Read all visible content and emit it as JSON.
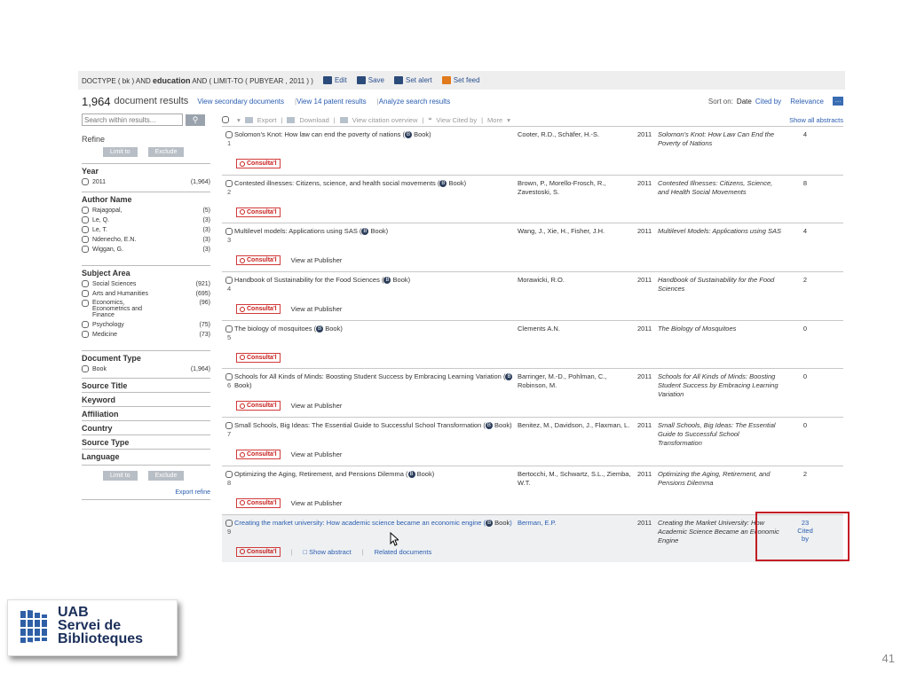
{
  "query": {
    "text_before": "DOCTYPE ( bk ) AND",
    "keyword": "education",
    "text_after": "AND ( LIMIT-TO ( PUBYEAR , 2011 ) )",
    "actions": [
      "Edit",
      "Save",
      "Set alert",
      "Set feed"
    ]
  },
  "results": {
    "count": "1,964",
    "label": "document results",
    "links": [
      "View secondary documents",
      "View 14 patent results",
      "Analyze search results"
    ],
    "sort_label": "Sort on:",
    "sort_options": [
      "Date",
      "Cited by",
      "Relevance"
    ]
  },
  "sidebar": {
    "search_placeholder": "Search within results...",
    "refine": "Refine",
    "limit_to": "Limit to",
    "exclude": "Exclude",
    "year": {
      "title": "Year",
      "items": [
        {
          "label": "2011",
          "count": "(1,964)"
        }
      ]
    },
    "author": {
      "title": "Author Name",
      "items": [
        {
          "label": "Rajagopal,",
          "count": "(5)"
        },
        {
          "label": "Le, Q.",
          "count": "(3)"
        },
        {
          "label": "Le, T.",
          "count": "(3)"
        },
        {
          "label": "Ndenecho, E.N.",
          "count": "(3)"
        },
        {
          "label": "Wiggan, G.",
          "count": "(3)"
        }
      ]
    },
    "subject": {
      "title": "Subject Area",
      "items": [
        {
          "label": "Social Sciences",
          "count": "(921)"
        },
        {
          "label": "Arts and Humanities",
          "count": "(695)"
        },
        {
          "label": "Economics, Econometrics and Finance",
          "count": "(96)"
        },
        {
          "label": "Psychology",
          "count": "(75)"
        },
        {
          "label": "Medicine",
          "count": "(73)"
        }
      ]
    },
    "doctype": {
      "title": "Document Type",
      "items": [
        {
          "label": "Book",
          "count": "(1,964)"
        }
      ]
    },
    "collapsed": [
      "Source Title",
      "Keyword",
      "Affiliation",
      "Country",
      "Source Type",
      "Language"
    ],
    "export_refine": "Export refine"
  },
  "toolbar": {
    "export": "Export",
    "download": "Download",
    "citation_overview": "View citation overview",
    "cited_by": "View Cited by",
    "more": "More",
    "show_all": "Show all abstracts"
  },
  "book_badge": "B",
  "book_label": "Book",
  "consulta": "Consulta'l",
  "view_publisher": "View at Publisher",
  "show_abstract": "Show abstract",
  "related_docs": "Related documents",
  "rows": [
    {
      "num": "1",
      "title": "Solomon's Knot: How law can end the poverty of nations",
      "authors": "Cooter, R.D., Schäfer, H.-S.",
      "year": "2011",
      "source": "Solomon's Knot: How Law Can End the Poverty of Nations",
      "cited": "4",
      "publisher": false
    },
    {
      "num": "2",
      "title": "Contested illnesses: Citizens, science, and health social movements",
      "authors": "Brown, P., Morello-Frosch, R., Zavestoski, S.",
      "year": "2011",
      "source": "Contested Illnesses: Citizens, Science, and Health Social Movements",
      "cited": "8",
      "publisher": false
    },
    {
      "num": "3",
      "title": "Multilevel models: Applications using SAS",
      "authors": "Wang, J., Xie, H., Fisher, J.H.",
      "year": "2011",
      "source": "Multilevel Models: Applications using SAS",
      "cited": "4",
      "publisher": true
    },
    {
      "num": "4",
      "title": "Handbook of Sustainability for the Food Sciences",
      "authors": "Morawicki, R.O.",
      "year": "2011",
      "source": "Handbook of Sustainability for the Food Sciences",
      "cited": "2",
      "publisher": true
    },
    {
      "num": "5",
      "title": "The biology of mosquitoes",
      "authors": "Clements A.N.",
      "year": "2011",
      "source": "The Biology of Mosquitoes",
      "cited": "0",
      "publisher": false
    },
    {
      "num": "6",
      "title": "Schools for All Kinds of Minds: Boosting Student Success by Embracing Learning Variation",
      "authors": "Barringer, M.-D., Pohlman, C., Robinson, M.",
      "year": "2011",
      "source": "Schools for All Kinds of Minds: Boosting Student Success by Embracing Learning Variation",
      "cited": "0",
      "publisher": true
    },
    {
      "num": "7",
      "title": "Small Schools, Big Ideas: The Essential Guide to Successful School Transformation",
      "authors": "Benitez, M., Davidson, J., Flaxman, L.",
      "year": "2011",
      "source": "Small Schools, Big Ideas: The Essential Guide to Successful School Transformation",
      "cited": "0",
      "publisher": true
    },
    {
      "num": "8",
      "title": "Optimizing the Aging, Retirement, and Pensions Dilemma",
      "authors": "Bertocchi, M., Schwartz, S.L., Ziemba, W.T.",
      "year": "2011",
      "source": "Optimizing the Aging, Retirement, and Pensions Dilemma",
      "cited": "2",
      "publisher": true
    },
    {
      "num": "9",
      "title": "Creating the market university: How academic science became an economic engine",
      "authors": "Berman, E.P.",
      "year": "2011",
      "source": "Creating the Market University: How Academic Science Became an Economic Engine",
      "cited": "23",
      "cited_label": "Cited by",
      "publisher": false,
      "highlight": true
    }
  ],
  "logo": {
    "line1": "UAB",
    "line2": "Servei de",
    "line3": "Biblioteques"
  },
  "page_number": "41"
}
